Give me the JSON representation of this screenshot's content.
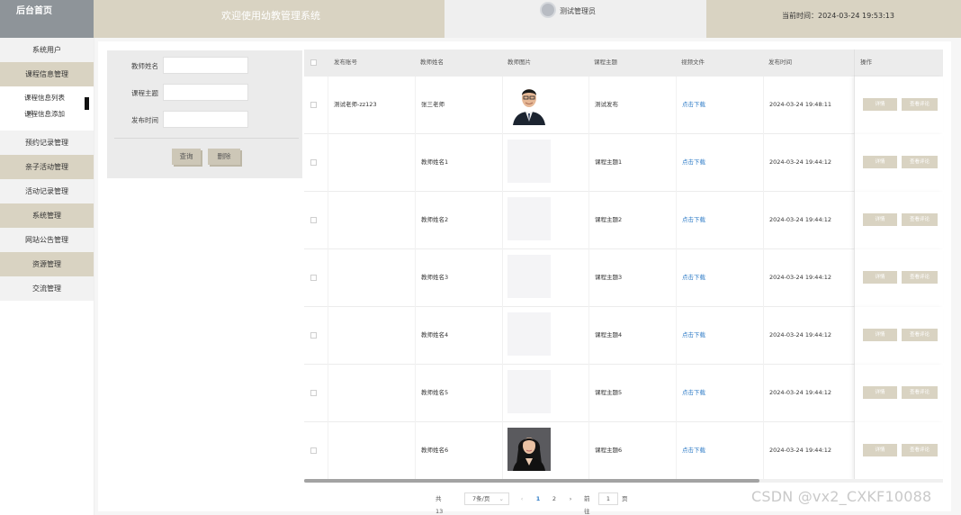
{
  "header": {
    "home": "后台首页",
    "title": "欢迎使用幼教管理系统",
    "username": "测试管理员",
    "time_label": "当前时间：",
    "time_value": "2024-03-24 19:53:13"
  },
  "sidebar": {
    "items": [
      {
        "label": "系统用户"
      },
      {
        "label": "课程信息管理"
      },
      {
        "label": "预约记录管理"
      },
      {
        "label": "亲子活动管理"
      },
      {
        "label": "活动记录管理"
      },
      {
        "label": "系统管理"
      },
      {
        "label": "网站公告管理"
      },
      {
        "label": "资源管理"
      },
      {
        "label": "交流管理"
      }
    ],
    "submenu": [
      {
        "label": "课程信息列表"
      },
      {
        "label": "课程信息添加"
      }
    ]
  },
  "search": {
    "fields": [
      {
        "label": "教师姓名",
        "value": ""
      },
      {
        "label": "课程主题",
        "value": ""
      },
      {
        "label": "发布时间",
        "value": ""
      }
    ],
    "query_label": "查询",
    "delete_label": "删除"
  },
  "table": {
    "columns": [
      "发布账号",
      "教师姓名",
      "教师图片",
      "课程主题",
      "视频文件",
      "发布时间",
      "操作"
    ],
    "rows": [
      {
        "account": "测试老师-zz123",
        "teacher": "张三老师",
        "photo": "male-portrait",
        "topic": "测试发布",
        "video": "点击下载",
        "time": "2024-03-24 19:48:11",
        "detail": "详情",
        "review": "查看评论"
      },
      {
        "account": "",
        "teacher": "教师姓名1",
        "photo": "",
        "topic": "课程主题1",
        "video": "点击下载",
        "time": "2024-03-24 19:44:12",
        "detail": "详情",
        "review": "查看评论"
      },
      {
        "account": "",
        "teacher": "教师姓名2",
        "photo": "",
        "topic": "课程主题2",
        "video": "点击下载",
        "time": "2024-03-24 19:44:12",
        "detail": "详情",
        "review": "查看评论"
      },
      {
        "account": "",
        "teacher": "教师姓名3",
        "photo": "",
        "topic": "课程主题3",
        "video": "点击下载",
        "time": "2024-03-24 19:44:12",
        "detail": "详情",
        "review": "查看评论"
      },
      {
        "account": "",
        "teacher": "教师姓名4",
        "photo": "",
        "topic": "课程主题4",
        "video": "点击下载",
        "time": "2024-03-24 19:44:12",
        "detail": "详情",
        "review": "查看评论"
      },
      {
        "account": "",
        "teacher": "教师姓名5",
        "photo": "",
        "topic": "课程主题5",
        "video": "点击下载",
        "time": "2024-03-24 19:44:12",
        "detail": "详情",
        "review": "查看评论"
      },
      {
        "account": "",
        "teacher": "教师姓名6",
        "photo": "female-portrait",
        "topic": "课程主题6",
        "video": "点击下载",
        "time": "2024-03-24 19:44:12",
        "detail": "详情",
        "review": "查看评论"
      }
    ]
  },
  "pagination": {
    "total": "共 13 条",
    "page_size": "7条/页",
    "pages": [
      "1",
      "2"
    ],
    "current_page": "1",
    "prev": "‹",
    "next": "›",
    "goto_label": "前往",
    "goto_value": "1",
    "goto_suffix": "页"
  },
  "watermark": "CSDN @vx2_CXKF10088",
  "colors": {
    "tan": "#d9d3c2",
    "gray_header": "#8e9499",
    "link": "#2f7cc7"
  }
}
